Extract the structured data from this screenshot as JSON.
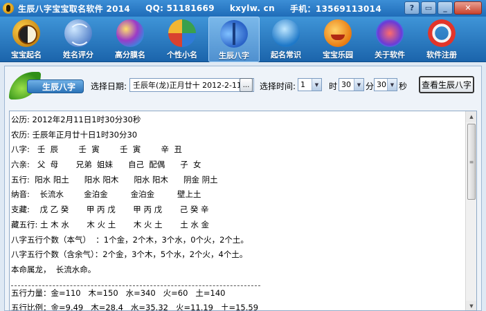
{
  "window": {
    "title": "生辰八字宝宝取名软件 2014",
    "qq": "QQ: 51181669",
    "site": "kxylw. cn",
    "phone": "手机：13569113014",
    "btn_help": "?",
    "btn_restore": "▭",
    "btn_min": "_",
    "btn_close": "✕"
  },
  "toolbar": {
    "items": [
      {
        "label": "宝宝起名",
        "icon": "yin-yang-icon"
      },
      {
        "label": "姓名评分",
        "icon": "globe-icon"
      },
      {
        "label": "高分膜名",
        "icon": "colorful-ball-icon"
      },
      {
        "label": "个性小名",
        "icon": "windows-blocks-icon"
      },
      {
        "label": "生辰八字",
        "icon": "butterfly-icon",
        "active": true
      },
      {
        "label": "起名常识",
        "icon": "person-icon"
      },
      {
        "label": "宝宝乐园",
        "icon": "cartoon-face-icon"
      },
      {
        "label": "关于软件",
        "icon": "wings-icon"
      },
      {
        "label": "软件注册",
        "icon": "lifebuoy-icon"
      }
    ]
  },
  "panel": {
    "badge": "生辰八字",
    "date_label": "选择日期:",
    "date_value": "壬辰年(龙)正月廿十 2012-2-11",
    "date_btn": "...",
    "time_label": "选择时间:",
    "hour": "1",
    "hour_unit": "时",
    "minute": "30",
    "minute_unit": "分",
    "second": "30",
    "second_unit": "秒",
    "view_button": "查看生辰八字"
  },
  "output": {
    "lines": [
      "公历: 2012年2月11日1时30分30秒",
      "农历: 壬辰年正月廿十日1时30分30",
      "八字:   壬  辰        壬  寅        壬  寅        辛  丑",
      "六亲:   父  母       兄弟  姐妹      自己  配偶      子  女",
      "五行:  阳水 阳土      阳水 阳木      阳水 阳木      阴金 阴土",
      "纳音:    长流水        金泊金         金泊金         壁上土",
      "支藏:    戊 乙 癸       甲 丙 戊       甲 丙 戊       己 癸 辛",
      "藏五行: 土 木 水       木 火 土       木 火 土       土 水 金",
      "八字五行个数（本气）  ：1个金，2个木，3个水，0个火，2个土。",
      "八字五行个数（含余气）：2个金，3个木，5个水，2个火，4个土。",
      "本命属龙，  长流水命。",
      "",
      "五行力量：金=110   木=150   水=340   火=60   土=140",
      "五行比例：金=9.49   木=28.4   水=35.32   火=11.19   土=15.59"
    ]
  }
}
